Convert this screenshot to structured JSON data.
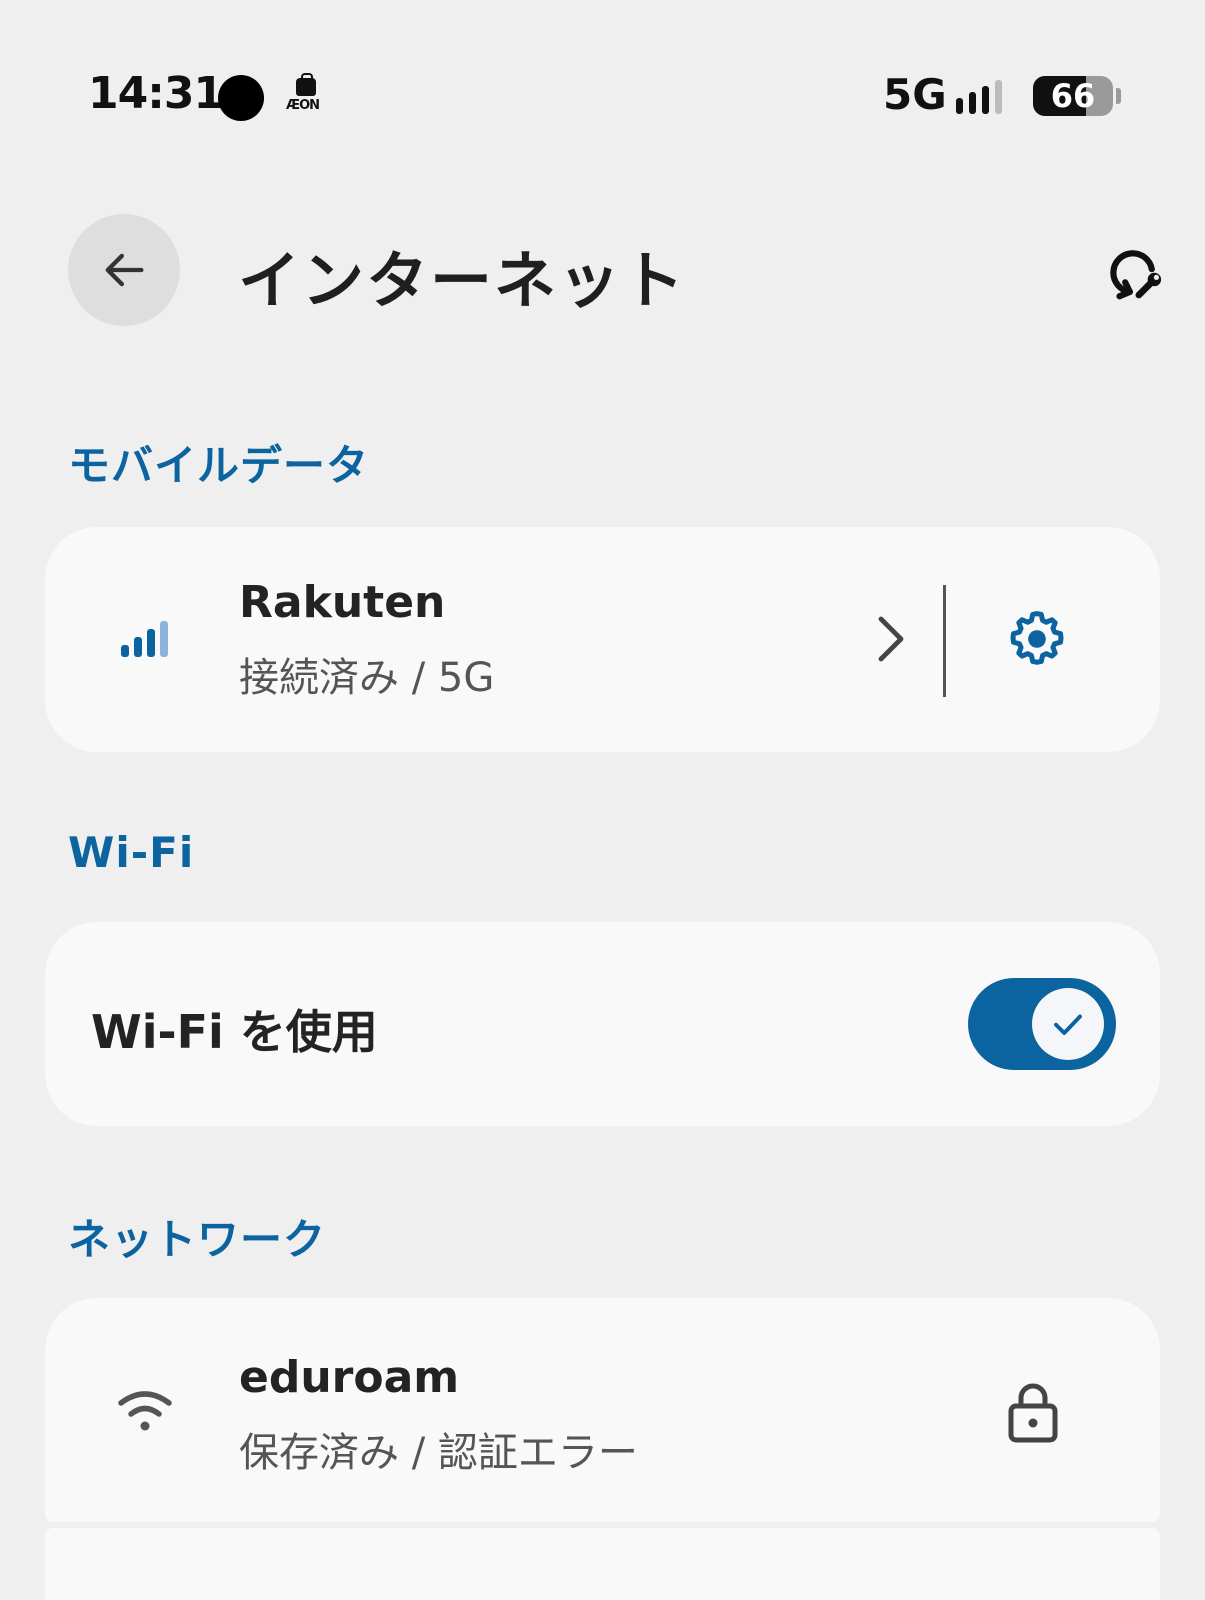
{
  "status_bar": {
    "time": "14:31",
    "aeon_label": "ÆON",
    "network_type": "5G",
    "battery_level": "66",
    "battery_fraction": 0.66,
    "signal_bars_active": 3,
    "signal_bars_total": 4
  },
  "header": {
    "title": "インターネット",
    "back_icon": "arrow-left-icon",
    "reset_icon": "network-reset-icon"
  },
  "mobile_data": {
    "section_label": "モバイルデータ",
    "carrier_name": "Rakuten",
    "status": "接続済み / 5G",
    "signal_bars_active": 3,
    "signal_bars_total": 4,
    "chevron_icon": "chevron-right-icon",
    "settings_icon": "gear-icon"
  },
  "wifi": {
    "section_label": "Wi-Fi",
    "use_wifi_label": "Wi-Fi を使用",
    "enabled": true
  },
  "networks": {
    "section_label": "ネットワーク",
    "items": [
      {
        "ssid": "eduroam",
        "status": "保存済み / 認証エラー",
        "icon": "wifi-icon",
        "secured": true
      }
    ]
  },
  "colors": {
    "accent": "#0b63a0",
    "background": "#efefef",
    "card": "#f9f9f9"
  }
}
